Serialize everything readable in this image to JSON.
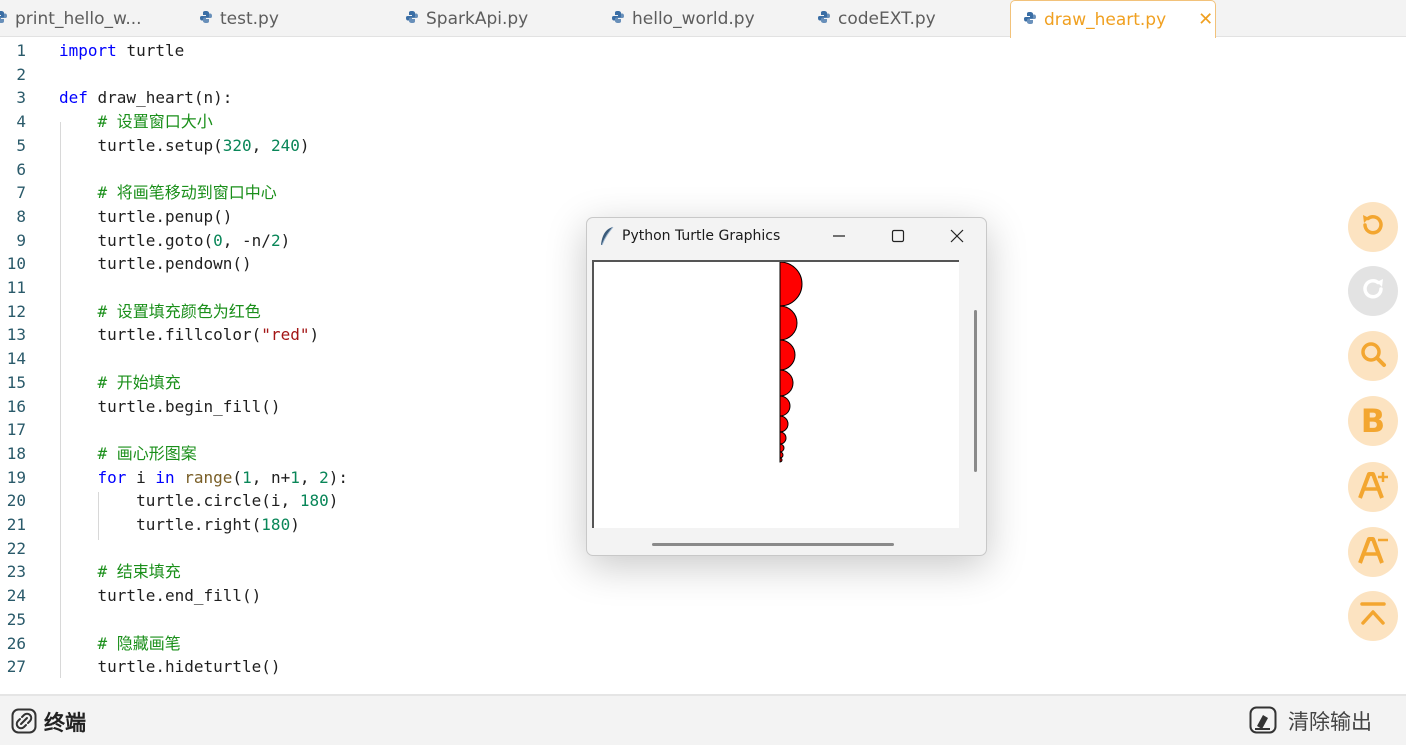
{
  "tabs": [
    {
      "label": "print_hello_w...",
      "active": false
    },
    {
      "label": "test.py",
      "active": false
    },
    {
      "label": "SparkApi.py",
      "active": false
    },
    {
      "label": "hello_world.py",
      "active": false
    },
    {
      "label": "codeEXT.py",
      "active": false
    },
    {
      "label": "draw_heart.py",
      "active": true
    }
  ],
  "tab_close_glyph": "✕",
  "editor": {
    "lines": [
      {
        "n": "1",
        "parts": [
          [
            "kw",
            "import"
          ],
          [
            "",
            "turtle"
          ]
        ]
      },
      {
        "n": "2",
        "parts": []
      },
      {
        "n": "3",
        "parts": [
          [
            "kw",
            "def"
          ],
          [
            "",
            "draw_heart(n):"
          ]
        ]
      },
      {
        "n": "4",
        "parts": [
          [
            "",
            "    "
          ],
          [
            "cm",
            "# 设置窗口大小"
          ]
        ]
      },
      {
        "n": "5",
        "parts": [
          [
            "",
            "    turtle.setup("
          ],
          [
            "num",
            "320"
          ],
          [
            "",
            ", "
          ],
          [
            "num",
            "240"
          ],
          [
            "",
            ")"
          ]
        ]
      },
      {
        "n": "6",
        "parts": []
      },
      {
        "n": "7",
        "parts": [
          [
            "",
            "    "
          ],
          [
            "cm",
            "# 将画笔移动到窗口中心"
          ]
        ]
      },
      {
        "n": "8",
        "parts": [
          [
            "",
            "    turtle.penup()"
          ]
        ]
      },
      {
        "n": "9",
        "parts": [
          [
            "",
            "    turtle.goto("
          ],
          [
            "num",
            "0"
          ],
          [
            "",
            ", -n/"
          ],
          [
            "num",
            "2"
          ],
          [
            "",
            ")"
          ]
        ]
      },
      {
        "n": "10",
        "parts": [
          [
            "",
            "    turtle.pendown()"
          ]
        ]
      },
      {
        "n": "11",
        "parts": []
      },
      {
        "n": "12",
        "parts": [
          [
            "",
            "    "
          ],
          [
            "cm",
            "# 设置填充颜色为红色"
          ]
        ]
      },
      {
        "n": "13",
        "parts": [
          [
            "",
            "    turtle.fillcolor("
          ],
          [
            "str",
            "\"red\""
          ],
          [
            "",
            ")"
          ]
        ]
      },
      {
        "n": "14",
        "parts": []
      },
      {
        "n": "15",
        "parts": [
          [
            "",
            "    "
          ],
          [
            "cm",
            "# 开始填充"
          ]
        ]
      },
      {
        "n": "16",
        "parts": [
          [
            "",
            "    turtle.begin_fill()"
          ]
        ]
      },
      {
        "n": "17",
        "parts": []
      },
      {
        "n": "18",
        "parts": [
          [
            "",
            "    "
          ],
          [
            "cm",
            "# 画心形图案"
          ]
        ]
      },
      {
        "n": "19",
        "parts": [
          [
            "",
            "    "
          ],
          [
            "kw",
            "for"
          ],
          [
            "",
            "",
            " i "
          ],
          [
            "kw",
            "in"
          ],
          [
            "",
            "",
            " "
          ],
          [
            "bi",
            "range"
          ],
          [
            "",
            "("
          ],
          [
            "num",
            "1"
          ],
          [
            "",
            ", n+"
          ],
          [
            "num",
            "1"
          ],
          [
            "",
            ", "
          ],
          [
            "num",
            "2"
          ],
          [
            "",
            "):"
          ]
        ]
      },
      {
        "n": "20",
        "parts": [
          [
            "",
            "        turtle.circle(i, "
          ],
          [
            "num",
            "180"
          ],
          [
            "",
            ")"
          ]
        ]
      },
      {
        "n": "21",
        "parts": [
          [
            "",
            "        turtle.right("
          ],
          [
            "num",
            "180"
          ],
          [
            "",
            ")"
          ]
        ]
      },
      {
        "n": "22",
        "parts": []
      },
      {
        "n": "23",
        "parts": [
          [
            "",
            "    "
          ],
          [
            "cm",
            "# 结束填充"
          ]
        ]
      },
      {
        "n": "24",
        "parts": [
          [
            "",
            "    turtle.end_fill()"
          ]
        ]
      },
      {
        "n": "25",
        "parts": []
      },
      {
        "n": "26",
        "parts": [
          [
            "",
            "    "
          ],
          [
            "cm",
            "# 隐藏画笔"
          ]
        ]
      },
      {
        "n": "27",
        "parts": [
          [
            "",
            "    turtle.hideturtle()"
          ]
        ]
      }
    ]
  },
  "side_buttons": [
    {
      "name": "undo-button",
      "icon": "undo-icon",
      "disabled": false
    },
    {
      "name": "redo-button",
      "icon": "redo-icon",
      "disabled": true
    },
    {
      "name": "search-button",
      "icon": "search-icon",
      "disabled": false
    },
    {
      "name": "bold-button",
      "icon": "bold-b-icon",
      "text": "B",
      "disabled": false
    },
    {
      "name": "font-increase-button",
      "icon": "font-increase-icon",
      "disabled": false
    },
    {
      "name": "font-decrease-button",
      "icon": "font-decrease-icon",
      "disabled": false
    },
    {
      "name": "scroll-top-button",
      "icon": "scroll-to-top-icon",
      "disabled": false
    }
  ],
  "turtle_window": {
    "title": "Python Turtle Graphics",
    "fill_color": "red"
  },
  "bottom": {
    "terminal_label": "终端",
    "clear_label": "清除输出"
  },
  "colors": {
    "accent": "#f0a020",
    "fab_bg": "#fce3c1",
    "fab_fg": "#f3a630",
    "keyword": "#0000ff",
    "number": "#098658",
    "string": "#a31515",
    "comment": "#1a8f1a",
    "heart_fill": "#ff0000"
  }
}
